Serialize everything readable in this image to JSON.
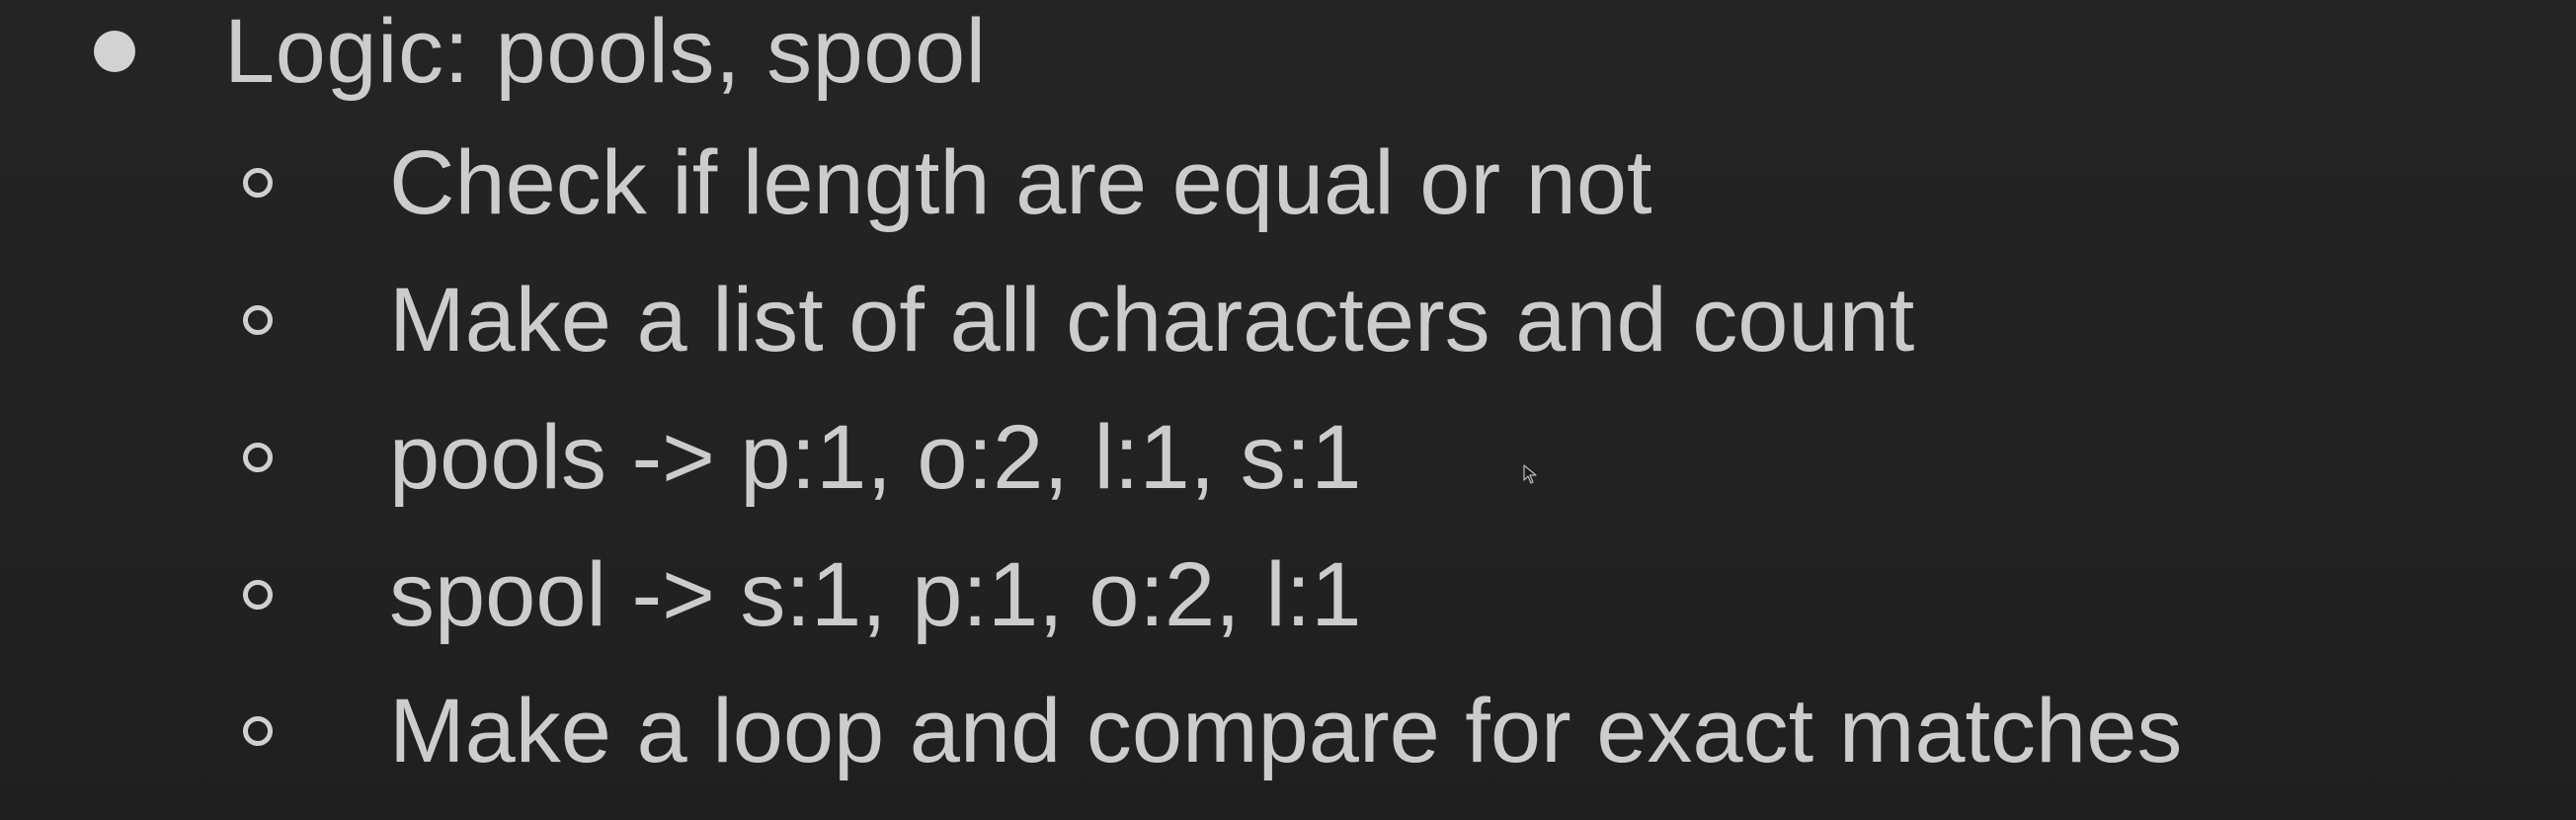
{
  "slide": {
    "main_bullet": "Logic: pools, spool",
    "sub_bullets": [
      "Check if length are equal or not",
      "Make a list of all characters and count",
      "pools -> p:1, o:2, l:1, s:1",
      "spool -> s:1, p:1, o:2, l:1",
      "Make a loop and compare for exact matches"
    ]
  },
  "colors": {
    "background": "#222222",
    "text": "#cccccc"
  },
  "icons": {
    "main_marker": "filled-circle-bullet-icon",
    "sub_marker": "hollow-circle-bullet-icon",
    "cursor": "mouse-pointer-icon"
  }
}
